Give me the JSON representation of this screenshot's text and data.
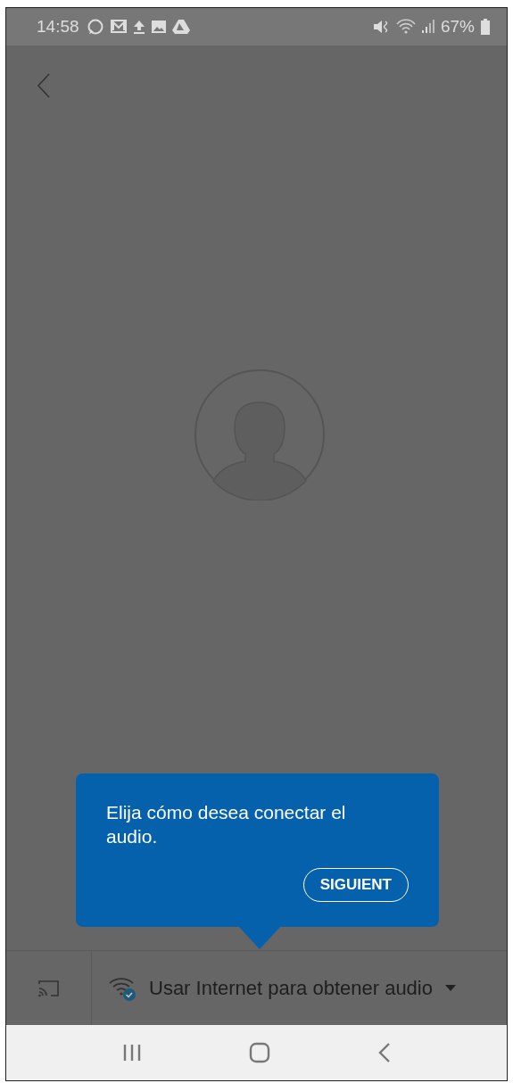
{
  "status_bar": {
    "time": "14:58",
    "battery": "67%"
  },
  "tooltip": {
    "message": "Elija cómo desea conectar el audio.",
    "button": "SIGUIENT"
  },
  "audio_bar": {
    "option": "Usar Internet para obtener audio",
    "connected": true
  }
}
